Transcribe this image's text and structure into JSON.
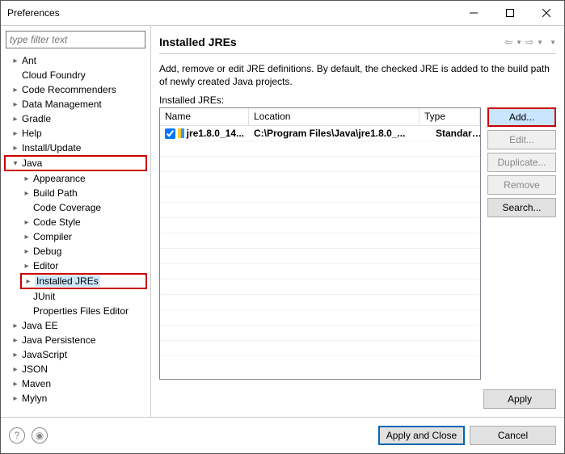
{
  "window": {
    "title": "Preferences"
  },
  "sidebar": {
    "filter_placeholder": "type filter text",
    "tree": [
      {
        "label": "Ant",
        "level": 1,
        "arrow": "▸"
      },
      {
        "label": "Cloud Foundry",
        "level": 1,
        "arrow": ""
      },
      {
        "label": "Code Recommenders",
        "level": 1,
        "arrow": "▸"
      },
      {
        "label": "Data Management",
        "level": 1,
        "arrow": "▸"
      },
      {
        "label": "Gradle",
        "level": 1,
        "arrow": "▸"
      },
      {
        "label": "Help",
        "level": 1,
        "arrow": "▸"
      },
      {
        "label": "Install/Update",
        "level": 1,
        "arrow": "▸"
      },
      {
        "label": "Java",
        "level": 1,
        "arrow": "▾",
        "highlight": "red-l1"
      },
      {
        "label": "Appearance",
        "level": 2,
        "arrow": "▸"
      },
      {
        "label": "Build Path",
        "level": 2,
        "arrow": "▸"
      },
      {
        "label": "Code Coverage",
        "level": 2,
        "arrow": ""
      },
      {
        "label": "Code Style",
        "level": 2,
        "arrow": "▸"
      },
      {
        "label": "Compiler",
        "level": 2,
        "arrow": "▸"
      },
      {
        "label": "Debug",
        "level": 2,
        "arrow": "▸"
      },
      {
        "label": "Editor",
        "level": 2,
        "arrow": "▸"
      },
      {
        "label": "Installed JREs",
        "level": 2,
        "arrow": "▸",
        "highlight": "red-l2",
        "selected": true
      },
      {
        "label": "JUnit",
        "level": 2,
        "arrow": ""
      },
      {
        "label": "Properties Files Editor",
        "level": 2,
        "arrow": ""
      },
      {
        "label": "Java EE",
        "level": 1,
        "arrow": "▸"
      },
      {
        "label": "Java Persistence",
        "level": 1,
        "arrow": "▸"
      },
      {
        "label": "JavaScript",
        "level": 1,
        "arrow": "▸"
      },
      {
        "label": "JSON",
        "level": 1,
        "arrow": "▸"
      },
      {
        "label": "Maven",
        "level": 1,
        "arrow": "▸"
      },
      {
        "label": "Mylyn",
        "level": 1,
        "arrow": "▸"
      }
    ]
  },
  "main": {
    "title": "Installed JREs",
    "description": "Add, remove or edit JRE definitions. By default, the checked JRE is added to the build path of newly created Java projects.",
    "table_label": "Installed JREs:",
    "columns": {
      "name": "Name",
      "location": "Location",
      "type": "Type"
    },
    "rows": [
      {
        "checked": true,
        "name": "jre1.8.0_14...",
        "location": "C:\\Program Files\\Java\\jre1.8.0_...",
        "type": "Standard ..."
      }
    ],
    "buttons": [
      {
        "label": "Add...",
        "enabled": true,
        "primary": true
      },
      {
        "label": "Edit...",
        "enabled": false
      },
      {
        "label": "Duplicate...",
        "enabled": false
      },
      {
        "label": "Remove",
        "enabled": false
      },
      {
        "label": "Search...",
        "enabled": true
      }
    ],
    "apply_label": "Apply"
  },
  "footer": {
    "apply_close": "Apply and Close",
    "cancel": "Cancel"
  }
}
